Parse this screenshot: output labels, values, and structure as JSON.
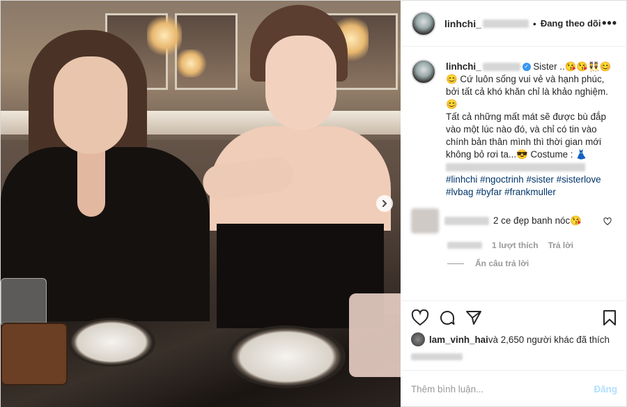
{
  "header": {
    "username": "linhchi_",
    "separator": "•",
    "follow_label": "Đang theo dõi",
    "more_label": "•••"
  },
  "caption": {
    "username": "linhchi_",
    "verified_mark": "✓",
    "text_line1": "Sister ..😘😘👯😊",
    "text_para1": "😊 Cứ luôn sống vui vẻ và hạnh phúc, bởi tất cả khó khăn chỉ là khảo nghiệm. 😊",
    "text_para2": "Tất cả những mất mát sẽ được bù đắp vào một lúc nào đó, và chỉ có tin vào chính bản thân mình thì thời gian mới không bỏ rơi ta...😎 Costume : 👗",
    "hashtags_line1": [
      "#linhchi",
      "#ngoctrinh",
      "#sister",
      "#sisterlove"
    ],
    "hashtags_line2": [
      "#lvbag",
      "#byfar",
      "#frankmuller"
    ]
  },
  "comment": {
    "text": "2 ce đẹp banh nóc😘",
    "likes": "1 lượt thích",
    "reply_label": "Trả lời",
    "hide_replies_label": "Ẩn câu trả lời"
  },
  "likes": {
    "user": "lam_vinh_hai",
    "rest": " và 2,650 người khác đã thích"
  },
  "add_comment": {
    "placeholder": "Thêm bình luận...",
    "post_label": "Đăng"
  },
  "icons": {
    "next": "chevron-right-icon",
    "heart": "heart-icon",
    "comment": "comment-icon",
    "share": "share-icon",
    "bookmark": "bookmark-icon"
  },
  "colors": {
    "verified": "#3897f0",
    "hashtag": "#003569",
    "post_disabled": "#b2dffc",
    "meta_gray": "#999999"
  }
}
